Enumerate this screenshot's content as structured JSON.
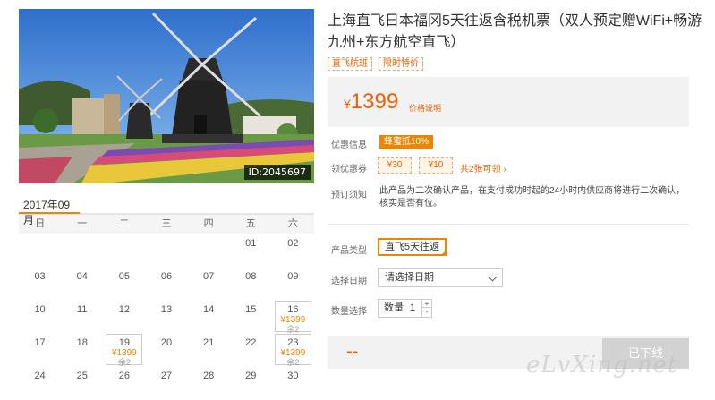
{
  "hero": {
    "image_id": "ID:2045697"
  },
  "calendar": {
    "month_tab": "2017年09月",
    "weekdays": [
      "日",
      "一",
      "二",
      "三",
      "四",
      "五",
      "六"
    ],
    "rows": [
      [
        {
          "day": ""
        },
        {
          "day": ""
        },
        {
          "day": ""
        },
        {
          "day": ""
        },
        {
          "day": ""
        },
        {
          "day": "01"
        },
        {
          "day": "02"
        }
      ],
      [
        {
          "day": "03"
        },
        {
          "day": "04"
        },
        {
          "day": "05"
        },
        {
          "day": "06"
        },
        {
          "day": "07"
        },
        {
          "day": "08"
        },
        {
          "day": "09"
        }
      ],
      [
        {
          "day": "10"
        },
        {
          "day": "11"
        },
        {
          "day": "12"
        },
        {
          "day": "13"
        },
        {
          "day": "14"
        },
        {
          "day": "15"
        },
        {
          "day": "16",
          "price": "¥1399",
          "rest": "余2"
        }
      ],
      [
        {
          "day": "17"
        },
        {
          "day": "18"
        },
        {
          "day": "19",
          "price": "¥1399",
          "rest": "余2"
        },
        {
          "day": "20"
        },
        {
          "day": "21"
        },
        {
          "day": "22"
        },
        {
          "day": "23",
          "price": "¥1399",
          "rest": "余2"
        }
      ],
      [
        {
          "day": "24"
        },
        {
          "day": "25"
        },
        {
          "day": "26"
        },
        {
          "day": "27"
        },
        {
          "day": "28"
        },
        {
          "day": "29"
        },
        {
          "day": "30"
        }
      ]
    ]
  },
  "product": {
    "title": "上海直飞日本福冈5天往返含税机票（双人预定赠WiFi+畅游九州+东方航空直飞）",
    "tags": [
      "直飞航班",
      "限时特价"
    ],
    "price_currency": "¥",
    "price_amount": "1399",
    "price_note": "价格说明"
  },
  "offers": {
    "label": "优惠信息",
    "deal": "蜂蜜抵10%"
  },
  "coupons": {
    "label": "领优惠券",
    "items": [
      "¥30",
      "¥10"
    ],
    "link": "共2张可领"
  },
  "notice": {
    "label": "预订须知",
    "text": "此产品为二次确认产品，在支付成功时起的24小时内供应商将进行二次确认，核实是否有位。"
  },
  "booking": {
    "type_label": "产品类型",
    "type_value": "直飞5天往返",
    "date_label": "选择日期",
    "date_placeholder": "请选择日期",
    "qty_label": "数量选择",
    "qty_text": "数量",
    "qty_value": "1",
    "qty_plus": "+",
    "qty_minus": "-"
  },
  "footer": {
    "total": "--",
    "offline_button": "已下线",
    "watermark": "eLvXing.net"
  },
  "colors": {
    "accent": "#f08300",
    "price": "#f06000"
  }
}
